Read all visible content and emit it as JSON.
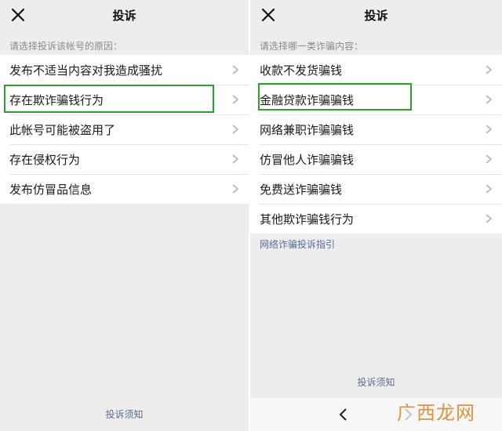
{
  "left": {
    "title": "投诉",
    "hint": "请选择投诉该帐号的原因：",
    "items": [
      {
        "label": "发布不适当内容对我造成骚扰"
      },
      {
        "label": "存在欺诈骗钱行为"
      },
      {
        "label": "此帐号可能被盗用了"
      },
      {
        "label": "存在侵权行为"
      },
      {
        "label": "发布仿冒品信息"
      }
    ],
    "footer": "投诉须知"
  },
  "right": {
    "title": "投诉",
    "hint": "请选择哪一类诈骗内容：",
    "items": [
      {
        "label": "收款不发货骗钱"
      },
      {
        "label": "金融贷款诈骗骗钱"
      },
      {
        "label": "网络兼职诈骗骗钱"
      },
      {
        "label": "仿冒他人诈骗骗钱"
      },
      {
        "label": "免费送诈骗骗钱"
      },
      {
        "label": "其他欺诈骗钱行为"
      }
    ],
    "guide_link": "网络诈骗投诉指引",
    "footer": "投诉须知"
  },
  "watermark": "广西龙网",
  "icons": {
    "close": "close-icon",
    "chevron": "chevron-right-icon",
    "back": "back-arrow-icon",
    "forward": "forward-arrow-icon"
  },
  "colors": {
    "highlight": "#2ca02c",
    "link": "#576b95",
    "background": "#ededed"
  }
}
